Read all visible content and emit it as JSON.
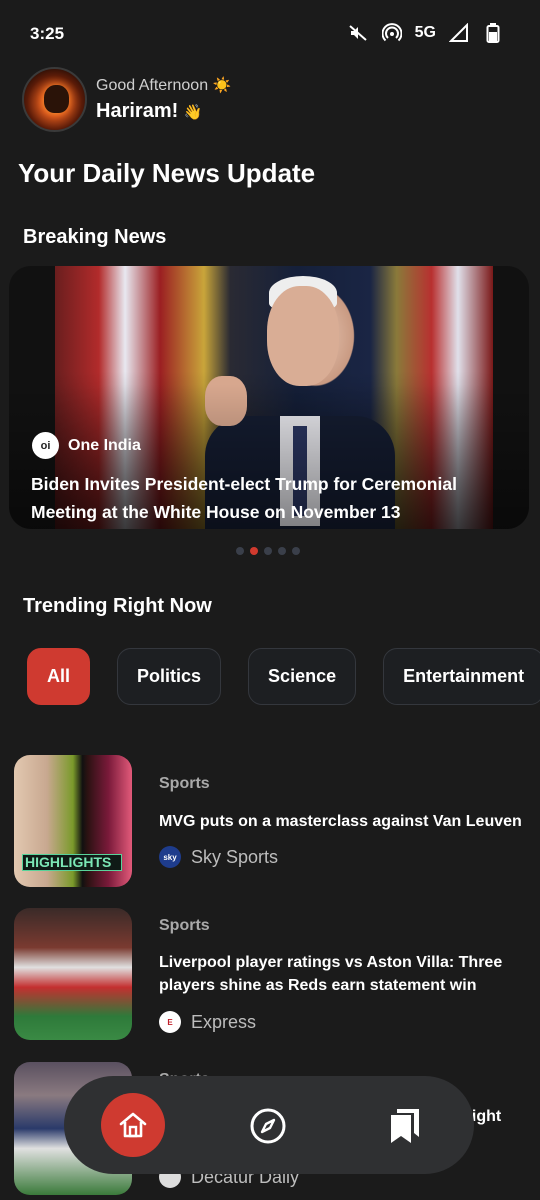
{
  "status_bar": {
    "time": "3:25",
    "network": "5G",
    "icons": [
      "mute-icon",
      "hotspot-icon",
      "signal-icon",
      "battery-icon"
    ]
  },
  "greeting": {
    "line": "Good Afternoon",
    "line_emoji": "☀️",
    "name": "Hariram!",
    "name_emoji": "👋"
  },
  "page_title": "Your Daily News Update",
  "breaking": {
    "section_title": "Breaking News",
    "source": "One India",
    "source_logo_text": "oi",
    "headline": "Biden Invites President-elect Trump for Ceremonial Meeting at the White House on November 13",
    "dots_total": 5,
    "active_dot": 2
  },
  "trending": {
    "section_title": "Trending Right Now",
    "chips": [
      {
        "label": "All",
        "active": true
      },
      {
        "label": "Politics",
        "active": false
      },
      {
        "label": "Science",
        "active": false
      },
      {
        "label": "Entertainment",
        "active": false
      }
    ]
  },
  "news": [
    {
      "category": "Sports",
      "title": "MVG puts on a masterclass against Van Leuven",
      "source": "Sky Sports",
      "source_logo": "sky",
      "thumb_label": "HIGHLIGHTS"
    },
    {
      "category": "Sports",
      "title": "Liverpool player ratings vs Aston Villa: Three players shine as Reds earn statement win",
      "source": "Express",
      "source_logo": "E"
    },
    {
      "category": "Sports",
      "title_partial": "aight",
      "source": "Decatur Daily"
    }
  ],
  "nav": {
    "items": [
      "home-icon",
      "compass-icon",
      "bookmarks-icon"
    ],
    "active_color": "#cf3a30"
  },
  "colors": {
    "background": "#1b1b1b",
    "accent": "#cf3a30"
  }
}
